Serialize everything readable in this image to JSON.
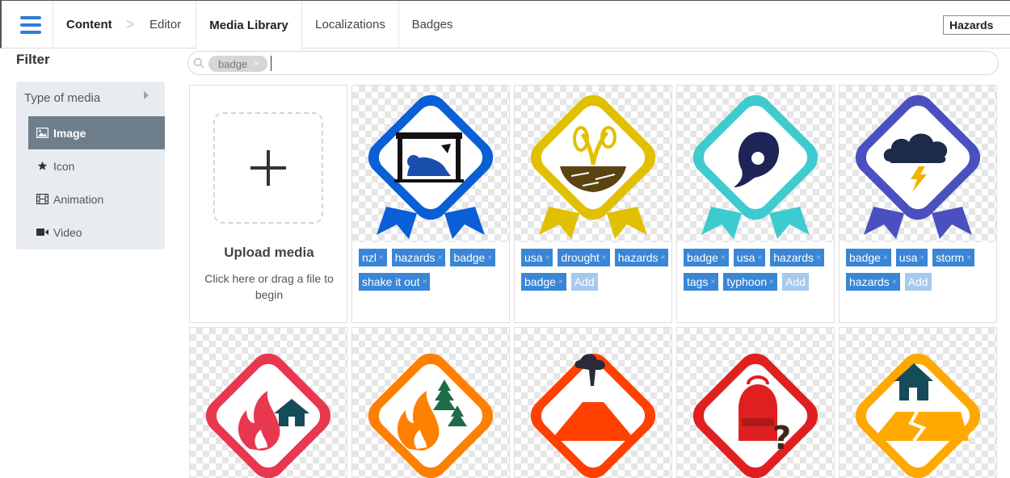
{
  "nav": {
    "breadcrumb": [
      "Content",
      "Editor"
    ],
    "breadcrumb_sep": ">",
    "tabs": [
      "Media Library",
      "Localizations",
      "Badges"
    ],
    "active_tab": "Media Library",
    "project_select": "Hazards"
  },
  "filter": {
    "title": "Filter",
    "type_label": "Type of media",
    "items": [
      {
        "label": "Image",
        "icon": "image-icon",
        "active": true
      },
      {
        "label": "Icon",
        "icon": "star-icon",
        "active": false
      },
      {
        "label": "Animation",
        "icon": "film-icon",
        "active": false
      },
      {
        "label": "Video",
        "icon": "video-camera-icon",
        "active": false
      }
    ]
  },
  "search": {
    "chip": "badge",
    "chip_remove": "×"
  },
  "upload": {
    "title": "Upload media",
    "subtitle": "Click here or drag a file to begin"
  },
  "tag_remove": "×",
  "add_label": "Add",
  "cards_row1": [
    {
      "badge": "shake-it-out-badge",
      "color": "#0a5fd6",
      "tags": [
        "nzl",
        "hazards",
        "badge",
        "shake it out"
      ]
    },
    {
      "badge": "drought-badge",
      "color": "#e0c000",
      "tags": [
        "usa",
        "drought",
        "hazards",
        "badge"
      ]
    },
    {
      "badge": "typhoon-badge",
      "color": "#3ecbcf",
      "tags": [
        "badge",
        "usa",
        "hazards",
        "tags",
        "typhoon"
      ]
    },
    {
      "badge": "storm-badge",
      "color": "#4a50bf",
      "tags": [
        "badge",
        "usa",
        "storm",
        "hazards"
      ]
    }
  ],
  "cards_row2": [
    {
      "badge": "house-fire-badge",
      "color": "#e8384f"
    },
    {
      "badge": "wildfire-badge",
      "color": "#ff7f00"
    },
    {
      "badge": "volcano-badge",
      "color": "#ff4000"
    },
    {
      "badge": "emergency-kit-badge",
      "color": "#e02020"
    },
    {
      "badge": "earthquake-badge",
      "color": "#ffa800"
    }
  ]
}
